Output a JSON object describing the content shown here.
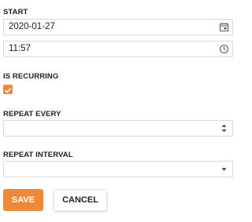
{
  "start": {
    "label": "START",
    "date_value": "2020-01-27",
    "time_value": "11:57",
    "date_icon": "calendar-icon",
    "time_icon": "clock-icon"
  },
  "recurring": {
    "label": "IS RECURRING",
    "checked": true,
    "icon": "checkmark-icon"
  },
  "repeat_every": {
    "label": "REPEAT EVERY",
    "value": "",
    "icon": "stepper-arrows-icon"
  },
  "repeat_interval": {
    "label": "REPEAT INTERVAL",
    "value": "",
    "icon": "chevron-down-icon"
  },
  "actions": {
    "save_label": "SAVE",
    "cancel_label": "CANCEL"
  },
  "colors": {
    "accent": "#f0883a",
    "border": "#d9d9d9",
    "text": "#222222"
  }
}
